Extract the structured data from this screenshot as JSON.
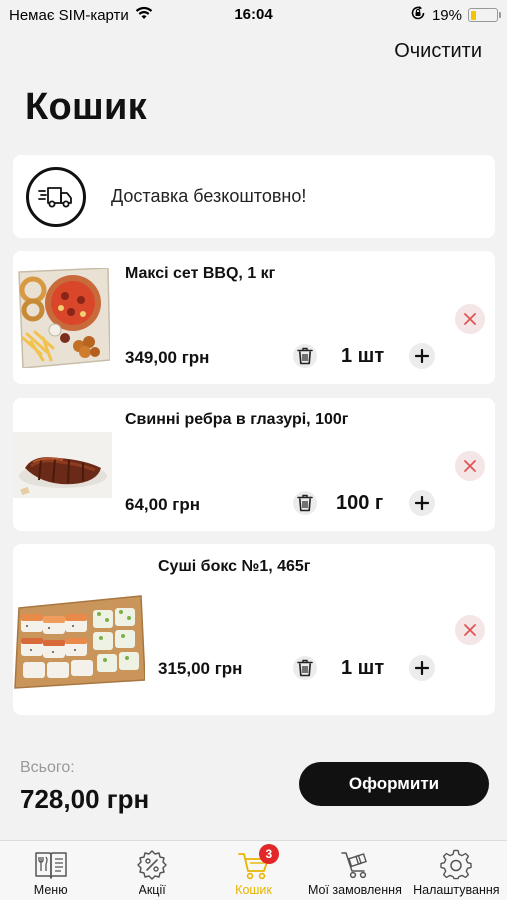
{
  "status_bar": {
    "carrier": "Немає SIM-карти",
    "time": "16:04",
    "battery": "19%",
    "battery_level": 0.19,
    "icons": [
      "wifi-icon",
      "orientation-lock-icon",
      "battery-icon"
    ]
  },
  "header": {
    "clear_label": "Очистити",
    "title": "Кошик"
  },
  "delivery": {
    "text": "Доставка безкоштовно!",
    "icon": "delivery-truck-icon"
  },
  "items": [
    {
      "name": "Максі сет BBQ, 1 кг",
      "price": "349,00 грн",
      "quantity": "1 шт",
      "image": "bbq-set-image"
    },
    {
      "name": "Свинні ребра в глазурі, 100г",
      "price": "64,00 грн",
      "quantity": "100 г",
      "image": "pork-ribs-image"
    },
    {
      "name": "Суші бокс №1, 465г",
      "price": "315,00 грн",
      "quantity": "1 шт",
      "image": "sushi-box-image"
    }
  ],
  "summary": {
    "total_label": "Всього:",
    "total_value": "728,00 грн",
    "checkout_label": "Оформити"
  },
  "tabbar": {
    "tabs": [
      {
        "label": "Меню",
        "icon": "menu-book-icon"
      },
      {
        "label": "Акції",
        "icon": "discount-icon"
      },
      {
        "label": "Кошик",
        "icon": "cart-icon",
        "badge": "3",
        "active": true
      },
      {
        "label": "Мої замовлення",
        "icon": "orders-cart-icon"
      },
      {
        "label": "Налаштування",
        "icon": "gear-icon"
      }
    ]
  },
  "colors": {
    "accent": "#e8b400",
    "badge": "#e12727",
    "button": "#111111",
    "remove": "#e05555"
  }
}
